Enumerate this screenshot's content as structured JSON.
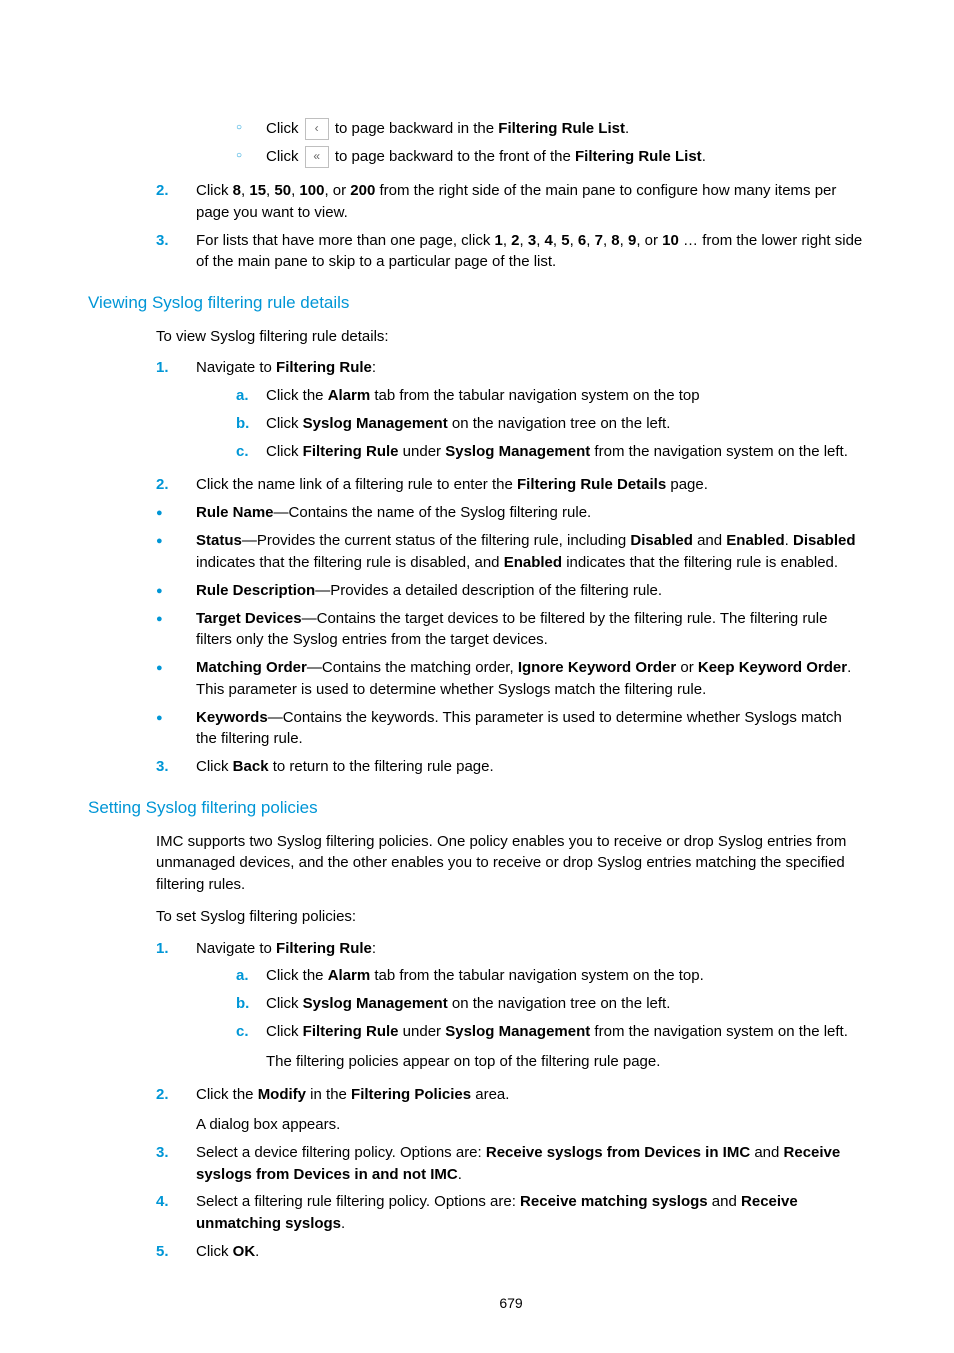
{
  "page_number": "679",
  "top_circ": {
    "item1": {
      "pre": "Click ",
      "icon_label": "‹",
      "post_a": " to page backward in the ",
      "bold_b": "Filtering Rule List",
      "post_b": "."
    },
    "item2": {
      "pre": "Click ",
      "icon_label": "«",
      "post_a": " to page backward to the front of the ",
      "bold_b": "Filtering Rule List",
      "post_b": "."
    }
  },
  "top_ol": {
    "n2": {
      "num": "2.",
      "t1": "Click ",
      "b1": "8",
      "c1": ", ",
      "b2": "15",
      "c2": ", ",
      "b3": "50",
      "c3": ", ",
      "b4": "100",
      "c4": ", or ",
      "b5": "200",
      "t2": " from the right side of the main pane to configure how many items per page you want to view."
    },
    "n3": {
      "num": "3.",
      "t1": "For lists that have more than one page, click ",
      "b1": "1",
      "c1": ", ",
      "b2": "2",
      "c2": ", ",
      "b3": "3",
      "c3": ", ",
      "b4": "4",
      "c4": ", ",
      "b5": "5",
      "c5": ", ",
      "b6": "6",
      "c6": ", ",
      "b7": "7",
      "c7": ", ",
      "b8": "8",
      "c8": ", ",
      "b9": "9",
      "c9": ", or ",
      "b10": "10",
      "t2": " … from the lower right side of the main pane to skip to a particular page of the list."
    }
  },
  "h1": "Viewing Syslog filtering rule details",
  "s1": {
    "intro": "To view Syslog filtering rule details:",
    "n1": {
      "num": "1.",
      "t1": "Navigate to ",
      "b1": "Filtering Rule",
      "t2": ":"
    },
    "a": {
      "m": "a.",
      "t1": "Click the ",
      "b1": "Alarm",
      "t2": " tab from the tabular navigation system on the top"
    },
    "b": {
      "m": "b.",
      "t1": "Click ",
      "b1": "Syslog Management",
      "t2": " on the navigation tree on the left."
    },
    "c": {
      "m": "c.",
      "t1": "Click ",
      "b1": "Filtering Rule",
      "t2": " under ",
      "b2": "Syslog Management",
      "t3": " from the navigation system on the left."
    },
    "n2": {
      "num": "2.",
      "t1": "Click the name link of a filtering rule to enter the ",
      "b1": "Filtering Rule Details",
      "t2": " page."
    },
    "bul": {
      "i1": {
        "b1": "Rule Name",
        "t1": "—Contains the name of the Syslog filtering rule."
      },
      "i2": {
        "b1": "Status",
        "t1": "—Provides the current status of the filtering rule, including ",
        "b2": "Disabled",
        "t2": " and ",
        "b3": "Enabled",
        "t3": ". ",
        "b4": "Disabled",
        "t4": " indicates that the filtering rule is disabled, and ",
        "b5": "Enabled",
        "t5": " indicates that the filtering rule is enabled."
      },
      "i3": {
        "b1": "Rule Description",
        "t1": "—Provides a detailed description of the filtering rule."
      },
      "i4": {
        "b1": "Target Devices",
        "t1": "—Contains the target devices to be filtered by the filtering rule. The filtering rule filters only the Syslog entries from the target devices."
      },
      "i5": {
        "b1": "Matching Order",
        "t1": "—Contains the matching order, ",
        "b2": "Ignore Keyword Order",
        "t2": " or ",
        "b3": "Keep Keyword Order",
        "t3": ". This parameter is used to determine whether Syslogs match the filtering rule."
      },
      "i6": {
        "b1": "Keywords",
        "t1": "—Contains the keywords. This parameter is used to determine whether Syslogs match the filtering rule."
      }
    },
    "n3": {
      "num": "3.",
      "t1": "Click ",
      "b1": "Back",
      "t2": " to return to the filtering rule page."
    }
  },
  "h2": "Setting Syslog filtering policies",
  "s2": {
    "intro": "IMC supports two Syslog filtering policies. One policy enables you to receive or drop Syslog entries from unmanaged devices, and the other enables you to receive or drop Syslog entries matching the specified filtering rules.",
    "intro2": "To set Syslog filtering policies:",
    "n1": {
      "num": "1.",
      "t1": "Navigate to ",
      "b1": "Filtering Rule",
      "t2": ":"
    },
    "a": {
      "m": "a.",
      "t1": "Click the ",
      "b1": "Alarm",
      "t2": " tab from the tabular navigation system on the top."
    },
    "b": {
      "m": "b.",
      "t1": "Click ",
      "b1": "Syslog Management",
      "t2": " on the navigation tree on the left."
    },
    "c": {
      "m": "c.",
      "t1": "Click ",
      "b1": "Filtering Rule",
      "t2": " under ",
      "b2": "Syslog Management",
      "t3": " from the navigation system on the left."
    },
    "c_extra": "The filtering policies appear on top of the filtering rule page.",
    "n2": {
      "num": "2.",
      "t1": "Click the ",
      "b1": "Modify",
      "t2": " in the ",
      "b2": "Filtering Policies",
      "t3": " area."
    },
    "n2_extra": "A dialog box appears.",
    "n3": {
      "num": "3.",
      "t1": "Select a device filtering policy. Options are: ",
      "b1": "Receive syslogs from Devices in IMC",
      "t2": " and ",
      "b2": "Receive syslogs from Devices in and not IMC",
      "t3": "."
    },
    "n4": {
      "num": "4.",
      "t1": "Select a filtering rule filtering policy. Options are: ",
      "b1": "Receive matching syslogs",
      "t2": " and ",
      "b2": "Receive unmatching syslogs",
      "t3": "."
    },
    "n5": {
      "num": "5.",
      "t1": "Click ",
      "b1": "OK",
      "t2": "."
    }
  }
}
